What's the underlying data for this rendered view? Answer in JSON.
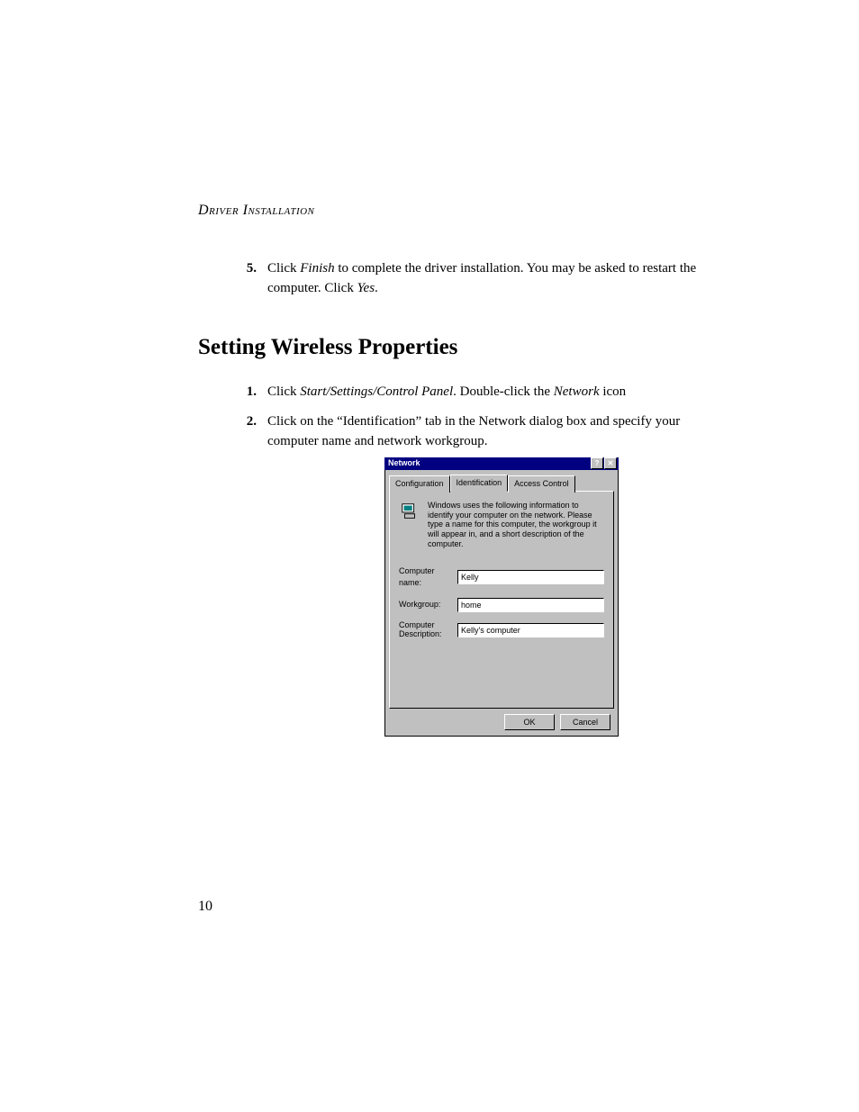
{
  "header": {
    "section": "Driver Installation"
  },
  "step5": {
    "num": "5.",
    "pre": "Click ",
    "em1": "Finish",
    "mid": " to complete the driver installation. You may be asked to restart the computer. Click ",
    "em2": "Yes",
    "post": "."
  },
  "heading": "Setting Wireless Properties",
  "step1": {
    "num": "1.",
    "pre": "Click ",
    "em1": "Start/Settings/Control Panel",
    "mid": ". Double-click the ",
    "em2": "Network",
    "post": " icon"
  },
  "step2": {
    "num": "2.",
    "text": "Click on the “Identification” tab in the Network dialog box and specify your computer name and network workgroup."
  },
  "dialog": {
    "title": "Network",
    "help_glyph": "?",
    "close_glyph": "✕",
    "tabs": {
      "t1": "Configuration",
      "t2": "Identification",
      "t3": "Access Control"
    },
    "info": "Windows uses the following information to identify your computer on the network. Please type a name for this computer, the workgroup it will appear in, and a short description of the computer.",
    "fields": {
      "computer_name_label": "Computer name:",
      "computer_name_value": "Kelly",
      "workgroup_label": "Workgroup:",
      "workgroup_value": "home",
      "description_label": "Computer Description:",
      "description_value": "Kelly's computer"
    },
    "buttons": {
      "ok": "OK",
      "cancel": "Cancel"
    }
  },
  "page_number": "10"
}
